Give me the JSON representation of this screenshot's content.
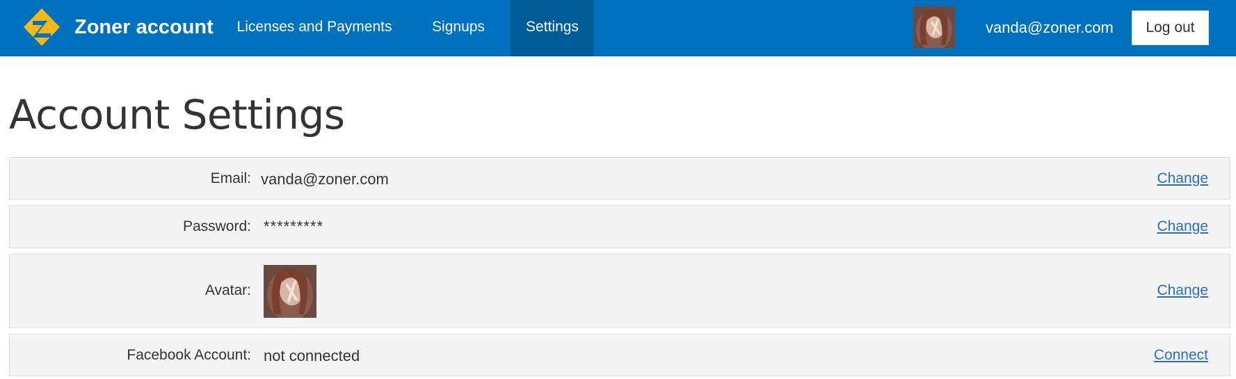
{
  "header": {
    "brand": "Zoner account",
    "nav": [
      {
        "label": "Licenses and Payments",
        "active": false
      },
      {
        "label": "Signups",
        "active": false
      },
      {
        "label": "Settings",
        "active": true
      }
    ],
    "user_email": "vanda@zoner.com",
    "logout_label": "Log out",
    "colors": {
      "bar": "#0071bc",
      "active_tab": "#005b99",
      "logo": "#f6b718"
    }
  },
  "page": {
    "title": "Account Settings"
  },
  "settings": {
    "email": {
      "label": "Email:",
      "value": "vanda@zoner.com",
      "action": "Change"
    },
    "password": {
      "label": "Password:",
      "value": "*********",
      "action": "Change"
    },
    "avatar": {
      "label": "Avatar:",
      "action": "Change"
    },
    "facebook": {
      "label": "Facebook Account:",
      "value": "not connected",
      "action": "Connect"
    }
  },
  "icons": {
    "logo": "zoner-logo-icon",
    "avatar": "user-avatar"
  }
}
